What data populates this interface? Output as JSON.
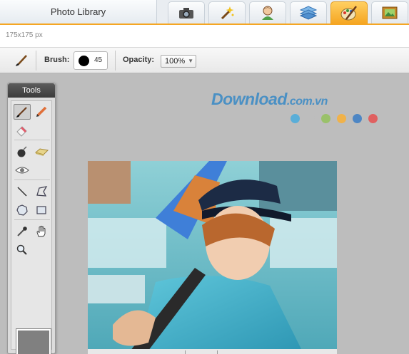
{
  "top_tabs": {
    "library_label": "Photo Library",
    "tabs": [
      {
        "icon": "camera-icon",
        "active": false
      },
      {
        "icon": "magic-wand-icon",
        "active": false
      },
      {
        "icon": "person-icon",
        "active": false
      },
      {
        "icon": "layers-icon",
        "active": false
      },
      {
        "icon": "paint-tools-icon",
        "active": true
      },
      {
        "icon": "picture-frame-icon",
        "active": false
      }
    ]
  },
  "info": {
    "size_label": "175x175 px"
  },
  "toolbar": {
    "brush_label": "Brush:",
    "brush_size": "45",
    "opacity_label": "Opacity:",
    "opacity_value": "100%"
  },
  "tools_panel": {
    "title": "Tools",
    "tools": [
      "brush-icon",
      "pencil-icon",
      "eraser-icon",
      "bomb-icon",
      "sponge-icon",
      "eye-icon",
      "line-icon",
      "polygon-lasso-icon",
      "blob-shape-icon",
      "rectangle-icon",
      "eyedropper-icon",
      "hand-icon",
      "magnifier-icon"
    ],
    "swatch_color": "#808080"
  },
  "watermark": {
    "brand": "Download",
    "suffix": ".com.vn",
    "dot_colors": [
      "#5aaed8",
      "#bfbfbf",
      "#9ac16a",
      "#f0b24a",
      "#4d86c4",
      "#e06060"
    ]
  },
  "colors": {
    "accent": "#f5a623",
    "canvas_bg": "#bdbdbd"
  }
}
